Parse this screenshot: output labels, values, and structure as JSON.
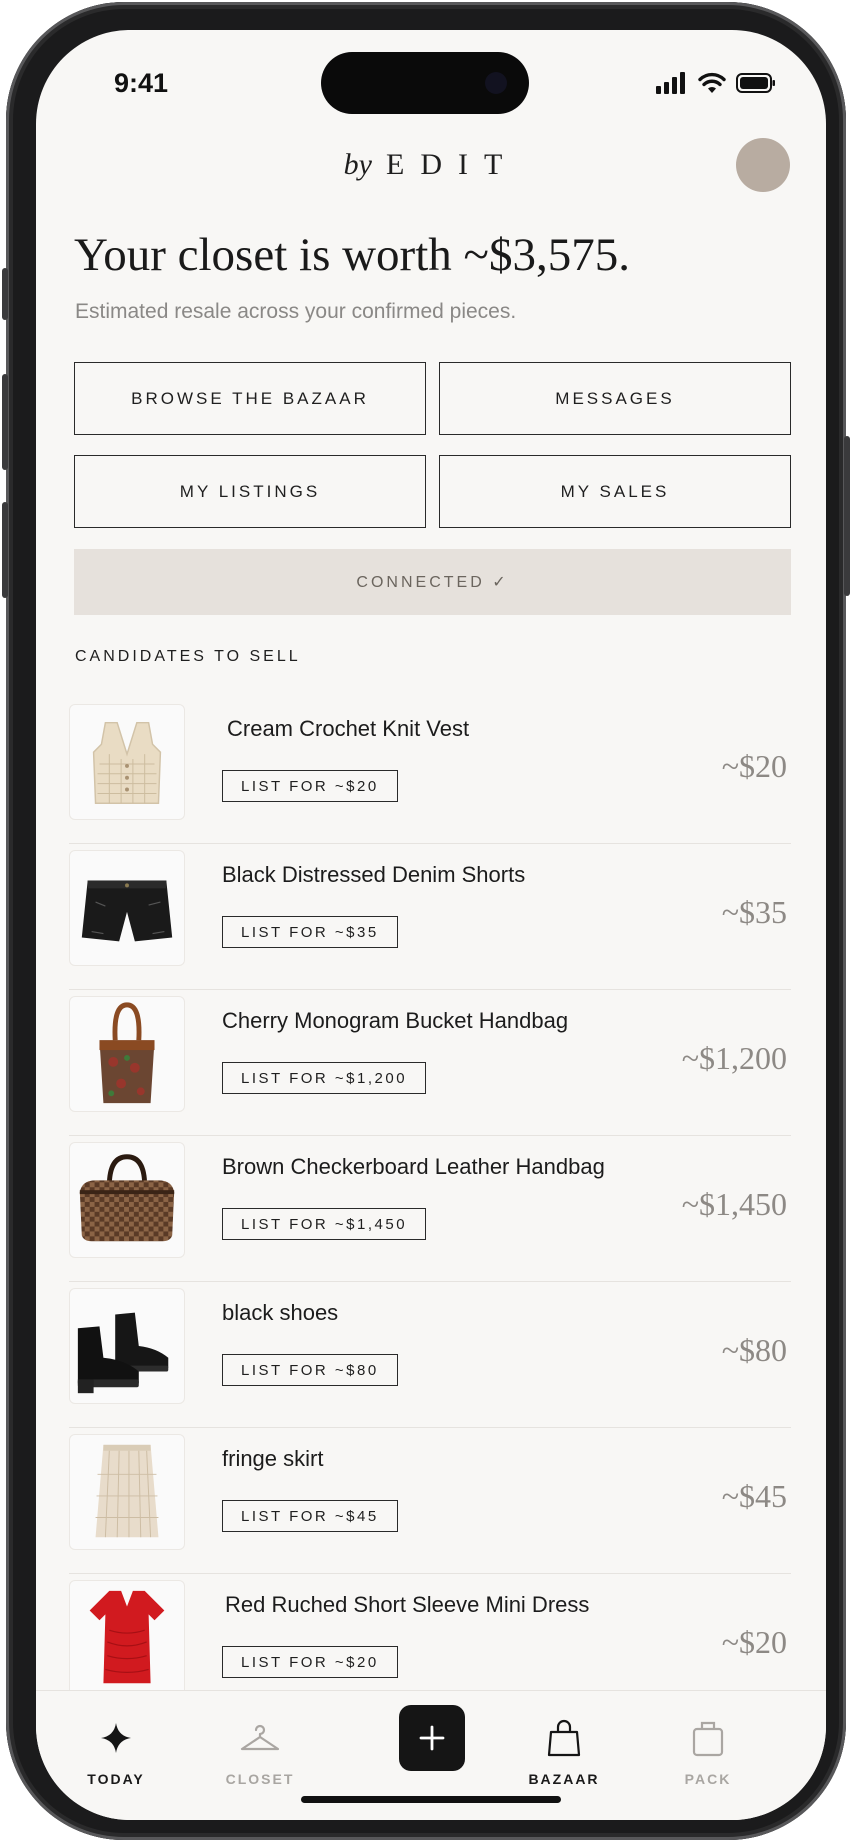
{
  "status_bar": {
    "time": "9:41"
  },
  "header": {
    "by": "by",
    "brand": "EDIT"
  },
  "summary": {
    "headline": "Your closet is worth ~$3,575.",
    "subline": "Estimated resale across your confirmed pieces."
  },
  "actions": {
    "browse": "BROWSE THE BAZAAR",
    "messages": "MESSAGES",
    "my_listings": "MY LISTINGS",
    "my_sales": "MY SALES",
    "connected": "CONNECTED ✓"
  },
  "section_title": "CANDIDATES TO SELL",
  "items": [
    {
      "name": "Cream Crochet Knit Vest",
      "button": "LIST FOR ~$20",
      "price": "~$20"
    },
    {
      "name": "Black Distressed Denim Shorts",
      "button": "LIST FOR ~$35",
      "price": "~$35"
    },
    {
      "name": "Cherry Monogram Bucket Handbag",
      "button": "LIST FOR ~$1,200",
      "price": "~$1,200"
    },
    {
      "name": "Brown Checkerboard Leather Handbag",
      "button": "LIST FOR ~$1,450",
      "price": "~$1,450"
    },
    {
      "name": "black shoes",
      "button": "LIST FOR ~$80",
      "price": "~$80"
    },
    {
      "name": "fringe skirt",
      "button": "LIST FOR ~$45",
      "price": "~$45"
    },
    {
      "name": "Red Ruched Short Sleeve Mini Dress",
      "button": "LIST FOR ~$20",
      "price": "~$20"
    }
  ],
  "tabbar": {
    "today": "TODAY",
    "closet": "CLOSET",
    "bazaar": "BAZAAR",
    "pack": "PACK"
  },
  "colors": {
    "background": "#f8f7f5",
    "connected_bg": "#e6e1dc",
    "avatar": "#b8aca1",
    "price_text": "#8d8985"
  }
}
